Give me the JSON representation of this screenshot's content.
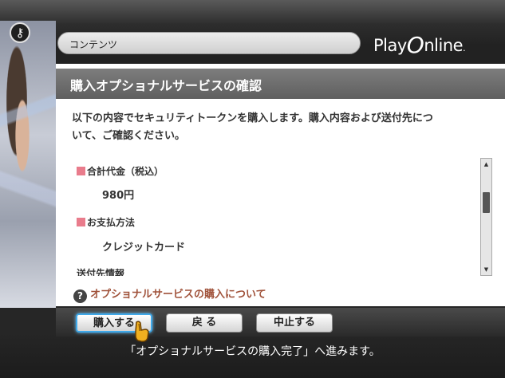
{
  "header": {
    "breadcrumb": "コンテンツ",
    "logo_play": "Play",
    "logo_o": "O",
    "logo_nline": "nline",
    "logo_dot": "."
  },
  "page": {
    "title": "購入オプショナルサービスの確認",
    "intro": "以下の内容でセキュリティトークンを購入します。購入内容および送付先につ\nいて、ご確認ください。"
  },
  "details": {
    "total_label": "合計代金（税込）",
    "total_value": "980円",
    "payment_label": "お支払方法",
    "payment_value": "クレジットカード",
    "shipping_label_partial": "送付先情報"
  },
  "help": {
    "label": "オプショナルサービスの購入について",
    "icon": "question-icon"
  },
  "buttons": {
    "purchase": "購入する",
    "back": "戻 る",
    "cancel": "中止する"
  },
  "footer": {
    "hint": "「オプショナルサービスの購入完了」へ進みます。"
  },
  "icons": {
    "key": "key-icon",
    "scroll_up": "▲",
    "scroll_down": "▼"
  },
  "colors": {
    "accent_pink": "#e97c8c",
    "link_brown": "#a0523a",
    "selection_blue": "#3fa8e8"
  }
}
